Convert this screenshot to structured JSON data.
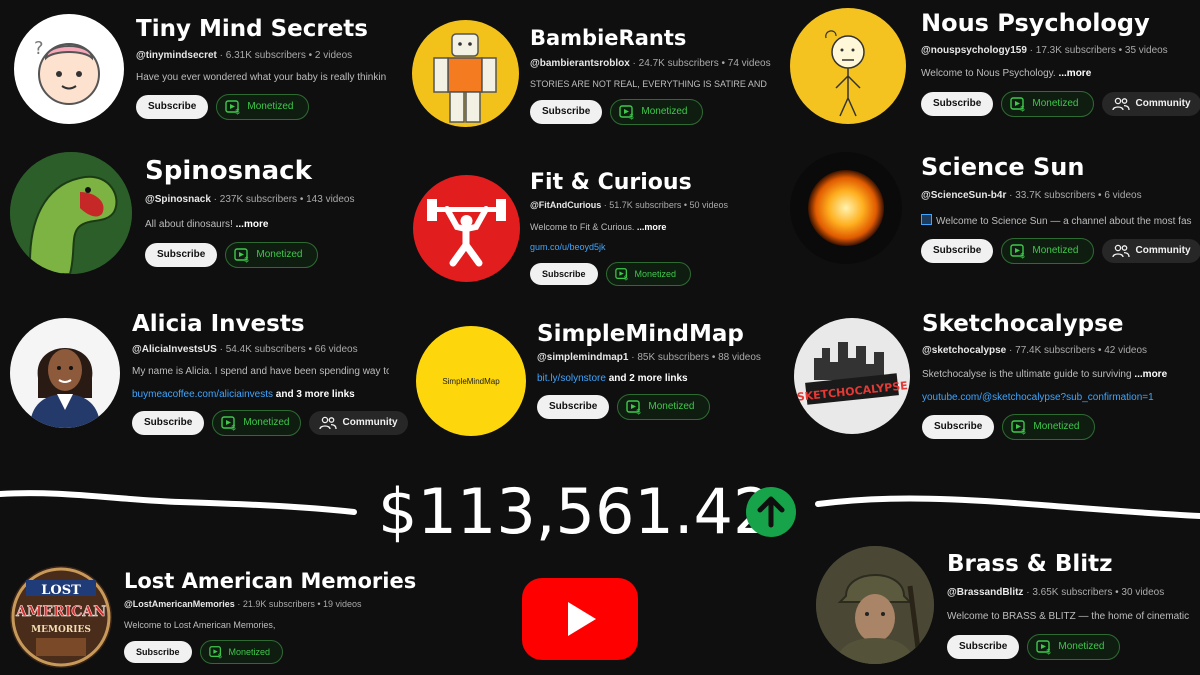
{
  "channels": [
    {
      "name": "Tiny Mind Secrets",
      "handle": "@tinymindsecret",
      "stats": "6.31K subscribers • 2 videos",
      "desc": "Have you ever wondered what your baby is really thinking?",
      "subscribe": "Subscribe",
      "monetized": "Monetized"
    },
    {
      "name": "BambieRants",
      "handle": "@bambierantsroblox",
      "stats": "24.7K subscribers • 74 videos",
      "desc": "STORIES ARE NOT REAL, EVERYTHING IS SATIRE AND",
      "subscribe": "Subscribe",
      "monetized": "Monetized"
    },
    {
      "name": "Nous Psychology",
      "handle": "@nouspsychology159",
      "stats": "17.3K subscribers • 35 videos",
      "desc": "Welcome to Nous Psychology.",
      "more": "...more",
      "subscribe": "Subscribe",
      "monetized": "Monetized",
      "community": "Community"
    },
    {
      "name": "Spinosnack",
      "handle": "@Spinosnack",
      "stats": "237K subscribers • 143 videos",
      "desc": "All about dinosaurs!",
      "more": "...more",
      "subscribe": "Subscribe",
      "monetized": "Monetized"
    },
    {
      "name": "Fit & Curious",
      "handle": "@FitAndCurious",
      "stats": "51.7K subscribers • 50 videos",
      "desc": "Welcome to Fit & Curious.",
      "more": "...more",
      "link": "gum.co/u/beoyd5jk",
      "subscribe": "Subscribe",
      "monetized": "Monetized"
    },
    {
      "name": "Science Sun",
      "handle": "@ScienceSun-b4r",
      "stats": "33.7K subscribers • 6 videos",
      "desc": "Welcome to Science Sun — a channel about the most fas",
      "subscribe": "Subscribe",
      "monetized": "Monetized",
      "community": "Community"
    },
    {
      "name": "Alicia Invests",
      "handle": "@AliciaInvestsUS",
      "stats": "54.4K subscribers • 66 videos",
      "desc": "My name is Alicia. I spend and have been spending way toc",
      "link": "buymeacoffee.com/aliciainvests",
      "link_more": "and 3 more links",
      "subscribe": "Subscribe",
      "monetized": "Monetized",
      "community": "Community"
    },
    {
      "name": "SimpleMindMap",
      "handle": "@simplemindmap1",
      "stats": "85K subscribers • 88 videos",
      "link": "bit.ly/solynstore",
      "link_more": "and 2 more links",
      "avatar_text": "SimpleMindMap",
      "subscribe": "Subscribe",
      "monetized": "Monetized"
    },
    {
      "name": "Sketchocalypse",
      "handle": "@sketchocalypse",
      "stats": "77.4K subscribers • 42 videos",
      "desc": "Sketchocalyse is the ultimate guide to surviving",
      "more": "...more",
      "link": "youtube.com/@sketchocalypse?sub_confirmation=1",
      "avatar_text": "SKETCHOCALYPSE",
      "subscribe": "Subscribe",
      "monetized": "Monetized"
    },
    {
      "name": "Lost American Memories",
      "handle": "@LostAmericanMemories",
      "stats": "21.9K subscribers • 19 videos",
      "desc": "Welcome to Lost American Memories,",
      "avatar_text_1": "LOST",
      "avatar_text_2": "AMERICAN",
      "avatar_text_3": "MEMORIES",
      "subscribe": "Subscribe",
      "monetized": "Monetized"
    },
    {
      "name": "Brass & Blitz",
      "handle": "@BrassandBlitz",
      "stats": "3.65K subscribers • 30 videos",
      "desc": "Welcome to BRASS & BLITZ — the home of cinematic",
      "subscribe": "Subscribe",
      "monetized": "Monetized"
    }
  ],
  "earnings": "$113,561.42",
  "icons": {
    "monetized": "dollar-play-icon",
    "community": "people-icon",
    "arrow": "arrow-up-icon",
    "youtube": "youtube-logo"
  },
  "colors": {
    "background": "#0f0f0f",
    "monetized_green": "#3ec84a",
    "arrow_green": "#16a34a",
    "youtube_red": "#ff0000",
    "link_blue": "#3ea6ff"
  }
}
